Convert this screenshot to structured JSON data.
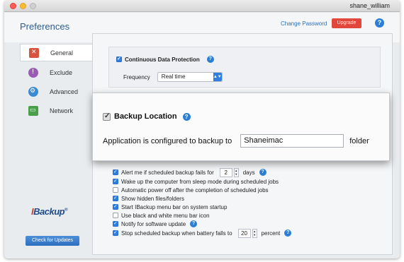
{
  "window": {
    "username": "shane_william"
  },
  "header": {
    "title": "Preferences",
    "change_password": "Change Password",
    "upgrade": "Upgrade",
    "help": "?"
  },
  "sidebar": {
    "items": [
      {
        "label": "General",
        "icon": "wrench-icon",
        "active": true
      },
      {
        "label": "Exclude",
        "icon": "exclamation-icon",
        "active": false
      },
      {
        "label": "Advanced",
        "icon": "gear-icon",
        "active": false
      },
      {
        "label": "Network",
        "icon": "network-icon",
        "active": false
      }
    ],
    "logo_prefix": "I",
    "logo_rest": "Backup",
    "logo_mark": "®",
    "check_updates": "Check for Updates"
  },
  "general": {
    "cdp_label": "Continuous Data Protection",
    "frequency_label": "Frequency",
    "frequency_value": "Real time",
    "options": [
      {
        "label": "Alert me if scheduled backup fails for",
        "checked": true,
        "value": "2",
        "suffix": "days"
      },
      {
        "label": "Wake up the computer from sleep mode during scheduled jobs",
        "checked": true
      },
      {
        "label": "Automatic power off after the completion of scheduled jobs",
        "checked": false
      },
      {
        "label": "Show hidden files/folders",
        "checked": true
      },
      {
        "label": "Start IBackup menu bar on system startup",
        "checked": true
      },
      {
        "label": "Use black and white menu bar icon",
        "checked": false
      },
      {
        "label": "Notify for software update",
        "checked": true
      },
      {
        "label": "Stop scheduled backup when battery falls to",
        "checked": true,
        "value": "20",
        "suffix": "percent"
      }
    ]
  },
  "backup_location": {
    "title": "Backup Location",
    "prefix": "Application is configured to backup to",
    "value": "Shaneimac",
    "suffix": "folder"
  }
}
